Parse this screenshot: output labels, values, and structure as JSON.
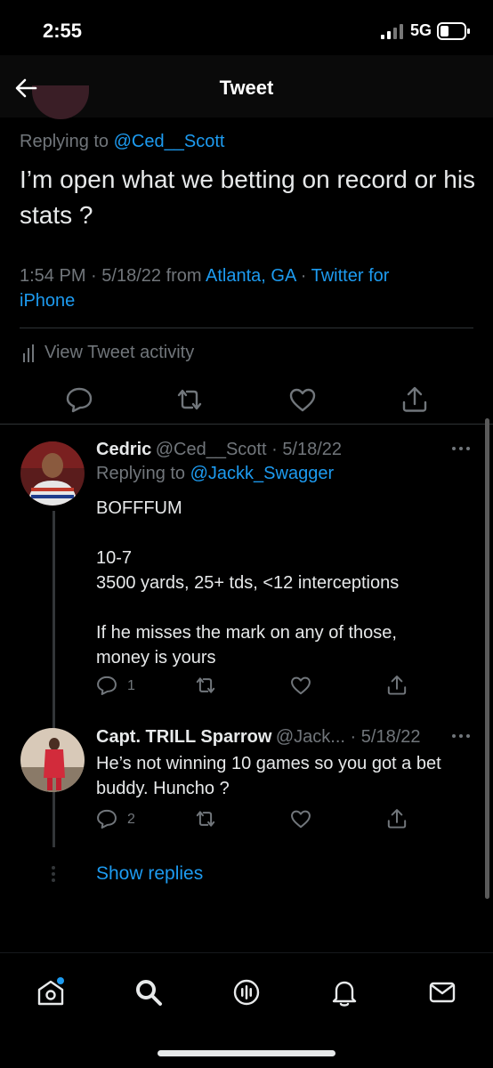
{
  "status_bar": {
    "time": "2:55",
    "network": "5G"
  },
  "header": {
    "title": "Tweet"
  },
  "main_tweet": {
    "replying_prefix": "Replying to",
    "replying_handle": "@Ced__Scott",
    "text": "I’m open what we betting on record or his stats ?",
    "time": "1:54 PM",
    "date": "5/18/22",
    "from_word": "from",
    "location": "Atlanta, GA",
    "client_part1": "Twitter for",
    "client_part2": "iPhone",
    "activity_label": "View Tweet activity"
  },
  "replies": [
    {
      "name": "Cedric",
      "handle": "@Ced__Scott",
      "date": "5/18/22",
      "replying_prefix": "Replying to",
      "replying_handle": "@Jackk_Swagger",
      "text": "BOFFFUM\n\n10-7\n3500 yards, 25+ tds, <12 interceptions\n\nIf he misses the mark on any of those,\nmoney is yours",
      "reply_count": "1"
    },
    {
      "name": "Capt. TRILL Sparrow",
      "handle": "@Jack...",
      "date": "5/18/22",
      "text": "He’s not winning 10 games so you got a bet\nbuddy. Huncho ?",
      "reply_count": "2"
    }
  ],
  "show_replies": "Show replies",
  "colors": {
    "accent": "#1d9bf0",
    "background": "#000000",
    "secondary_text": "#71767b"
  },
  "bottom_nav": [
    "home-icon",
    "search-icon",
    "spaces-icon",
    "notifications-icon",
    "messages-icon"
  ]
}
